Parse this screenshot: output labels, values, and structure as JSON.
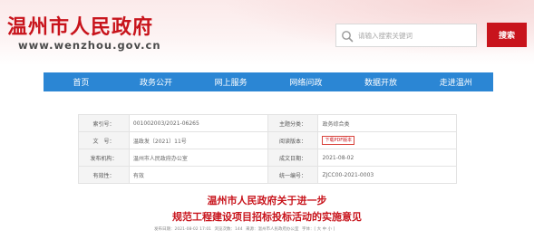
{
  "header": {
    "site_title": "温州市人民政府",
    "site_url": "www.wenzhou.gov.cn"
  },
  "search": {
    "placeholder": "请输入搜索关键词",
    "button_label": "搜索"
  },
  "nav": {
    "items": [
      "首页",
      "政务公开",
      "网上服务",
      "网络问政",
      "数据开放",
      "走进温州"
    ]
  },
  "meta": {
    "rows": [
      {
        "label1": "索引号：",
        "value1": "001002003/2021-06265",
        "label2": "主题分类：",
        "value2": "政务综合类"
      },
      {
        "label1": "文　号：",
        "value1": "温政发〔2021〕11号",
        "label2": "阅读版本：",
        "value2": "下载PDF版本"
      },
      {
        "label1": "发布机构：",
        "value1": "温州市人民政府办公室",
        "label2": "成文日期：",
        "value2": "2021-08-02"
      },
      {
        "label1": "有效性：",
        "value1": "有效",
        "label2": "统一编号：",
        "value2": "ZJCC00-2021-0003"
      }
    ]
  },
  "document": {
    "title_line1": "温州市人民政府关于进一步",
    "title_line2": "规范工程建设项目招标投标活动的实施意见",
    "info": {
      "publish_date": "发布日期：2021-08-02 17:01",
      "views": "浏览次数：144",
      "source": "来源：温州市人民政府办公室",
      "font_size": "字体：[ 大 中 小 ]"
    }
  },
  "colors": {
    "brand_red": "#c8141c",
    "nav_blue": "#2b86d4"
  }
}
